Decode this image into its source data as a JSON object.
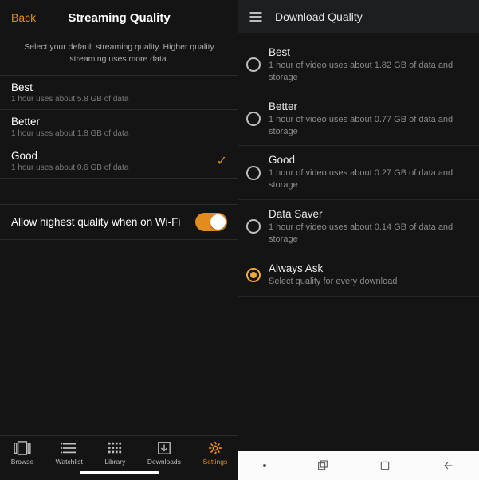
{
  "ios": {
    "back": "Back",
    "title": "Streaming Quality",
    "subtitle": "Select your default streaming quality. Higher quality streaming uses more data.",
    "options": {
      "best": {
        "title": "Best",
        "sub": "1 hour uses about 5.8 GB of data"
      },
      "better": {
        "title": "Better",
        "sub": "1 hour uses about 1.8 GB of data"
      },
      "good": {
        "title": "Good",
        "sub": "1 hour uses about 0.6 GB of data"
      }
    },
    "wifi_label": "Allow highest quality when on Wi-Fi",
    "tabs": {
      "browse": "Browse",
      "watchlist": "Watchlist",
      "library": "Library",
      "downloads": "Downloads",
      "settings": "Settings"
    }
  },
  "android": {
    "title": "Download Quality",
    "options": {
      "best": {
        "title": "Best",
        "sub": "1 hour of video uses about 1.82 GB of data and storage"
      },
      "better": {
        "title": "Better",
        "sub": "1 hour of video uses about 0.77 GB of data and storage"
      },
      "good": {
        "title": "Good",
        "sub": "1 hour of video uses about 0.27 GB of data and storage"
      },
      "saver": {
        "title": "Data Saver",
        "sub": "1 hour of video uses about 0.14 GB of data and storage"
      },
      "ask": {
        "title": "Always Ask",
        "sub": "Select quality for every download"
      }
    }
  }
}
